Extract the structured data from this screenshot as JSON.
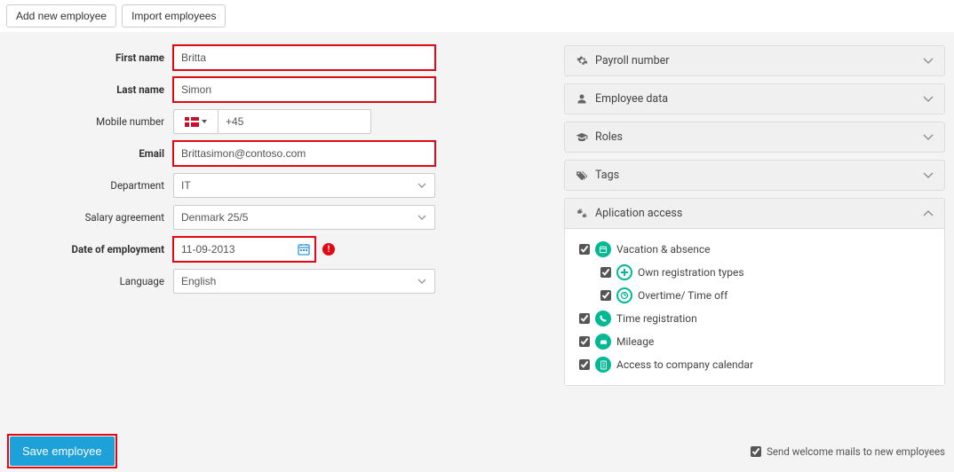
{
  "topbar": {
    "add_new_label": "Add new employee",
    "import_label": "Import employees"
  },
  "form": {
    "first_name_label": "First name",
    "first_name_value": "Britta",
    "last_name_label": "Last name",
    "last_name_value": "Simon",
    "mobile_label": "Mobile number",
    "mobile_prefix": "+45",
    "email_label": "Email",
    "email_value": "Brittasimon@contoso.com",
    "department_label": "Department",
    "department_value": "IT",
    "salary_label": "Salary agreement",
    "salary_value": "Denmark 25/5",
    "doe_label": "Date of employment",
    "doe_value": "11-09-2013",
    "language_label": "Language",
    "language_value": "English"
  },
  "accordions": {
    "payroll": {
      "title": "Payroll number"
    },
    "employee_data": {
      "title": "Employee data"
    },
    "roles": {
      "title": "Roles"
    },
    "tags": {
      "title": "Tags"
    },
    "app_access": {
      "title": "Aplication access",
      "items": {
        "vacation": "Vacation & absence",
        "own_reg": "Own registration types",
        "overtime": "Overtime/ Time off",
        "time_reg": "Time registration",
        "mileage": "Mileage",
        "calendar": "Access to company calendar"
      }
    }
  },
  "footer": {
    "save_label": "Save employee",
    "welcome_mail_label": "Send welcome mails to new employees"
  }
}
